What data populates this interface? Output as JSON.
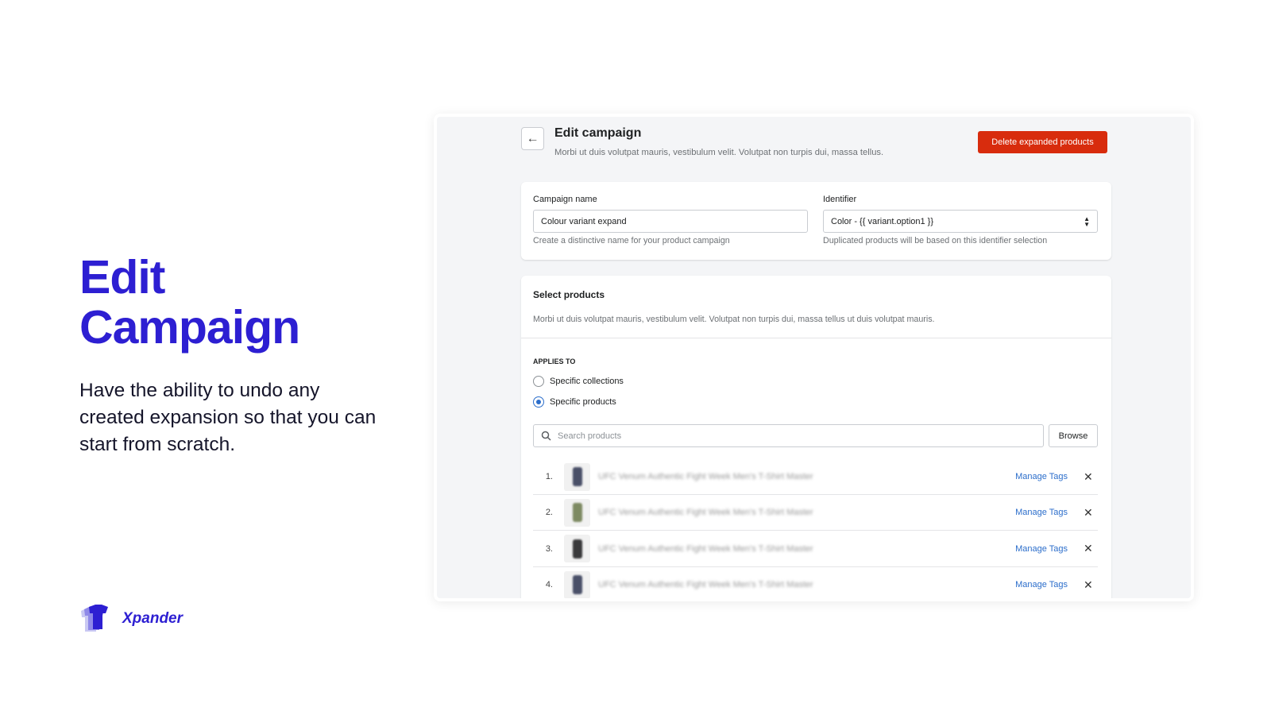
{
  "hero": {
    "title_line1": "Edit",
    "title_line2": "Campaign",
    "subtitle": "Have the ability to undo any created expansion so that you can start from scratch."
  },
  "brand": {
    "name": "Xpander",
    "color": "#2d1fd2"
  },
  "app": {
    "page_title": "Edit campaign",
    "page_description": "Morbi ut duis volutpat mauris, vestibulum velit. Volutpat non turpis dui, massa tellus.",
    "delete_button": "Delete expanded products",
    "campaign_name": {
      "label": "Campaign name",
      "value": "Colour variant expand",
      "help": "Create a distinctive name for your product campaign"
    },
    "identifier": {
      "label": "Identifier",
      "value": "Color - {{ variant.option1 }}",
      "help": "Duplicated products will be based on this identifier selection"
    },
    "select_products": {
      "title": "Select products",
      "description": "Morbi ut duis volutpat mauris, vestibulum velit. Volutpat non turpis dui, massa tellus ut duis volutpat mauris.",
      "applies_to_label": "APPLIES TO",
      "options": [
        {
          "label": "Specific collections",
          "selected": false
        },
        {
          "label": "Specific products",
          "selected": true
        }
      ],
      "search_placeholder": "Search products",
      "browse_button": "Browse",
      "products": [
        {
          "index": "1.",
          "name": "UFC Venum Authentic Fight Week Men's T-Shirt Master",
          "action": "Manage Tags",
          "shirt_color": "#4a5068"
        },
        {
          "index": "2.",
          "name": "UFC Venum Authentic Fight Week Men's T-Shirt Master",
          "action": "Manage Tags",
          "shirt_color": "#7d8a62"
        },
        {
          "index": "3.",
          "name": "UFC Venum Authentic Fight Week Men's T-Shirt Master",
          "action": "Manage Tags",
          "shirt_color": "#3a3a3c"
        },
        {
          "index": "4.",
          "name": "UFC Venum Authentic Fight Week Men's T-Shirt Master",
          "action": "Manage Tags",
          "shirt_color": "#4a5068"
        }
      ]
    }
  },
  "colors": {
    "danger": "#d82c0d",
    "link": "#2c6ecb"
  }
}
